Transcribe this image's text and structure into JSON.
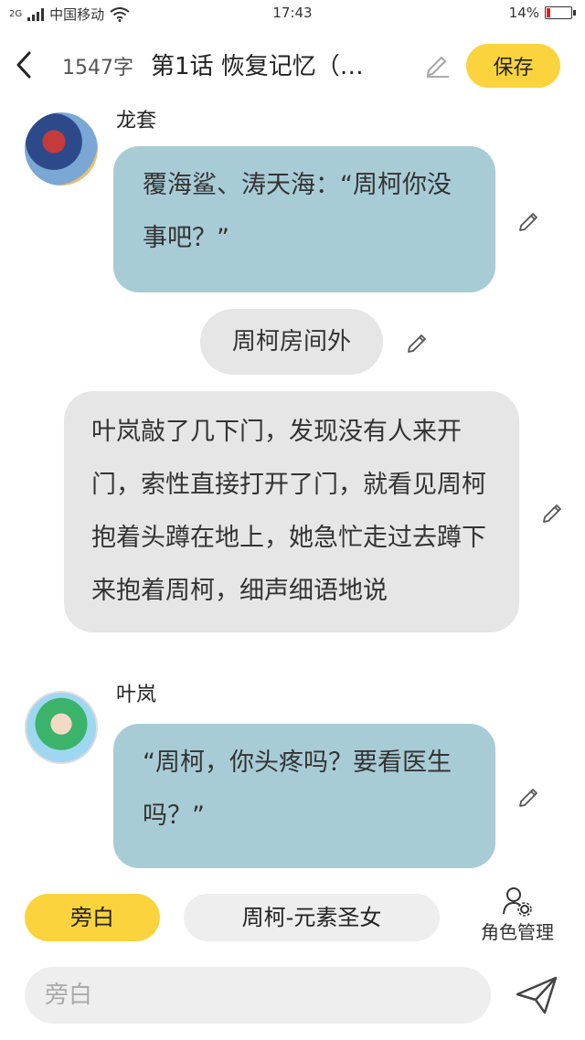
{
  "status": {
    "carrier_net": "2G",
    "carrier": "中国移动",
    "time": "17:43",
    "battery": "14%",
    "battery_level": 0.14
  },
  "header": {
    "word_count": "1547字",
    "title": "第1话  恢复记忆（…",
    "save_label": "保存"
  },
  "messages": {
    "m1": {
      "speaker": "龙套",
      "text": "覆海鲨、涛天海：“周柯你没事吧？”"
    },
    "scene": {
      "text": "周柯房间外"
    },
    "narration": {
      "text": "叶岚敲了几下门，发现没有人来开门，索性直接打开了门，就看见周柯抱着头蹲在地上，她急忙走过去蹲下来抱着周柯，细声细语地说"
    },
    "m2": {
      "speaker": "叶岚",
      "text": "“周柯，你头疼吗？要看医生吗？”"
    }
  },
  "bottom": {
    "role_narration": "旁白",
    "role_character": "周柯-元素圣女",
    "role_manager": "角色管理",
    "input_placeholder": "旁白"
  },
  "colors": {
    "accent": "#fbd43d",
    "bubble_blue": "#a8ccd6",
    "bubble_grey": "#e6e6e6"
  },
  "icons": [
    "back-icon",
    "wifi-icon",
    "battery-icon",
    "edit-icon",
    "role-manager-icon",
    "send-icon"
  ]
}
